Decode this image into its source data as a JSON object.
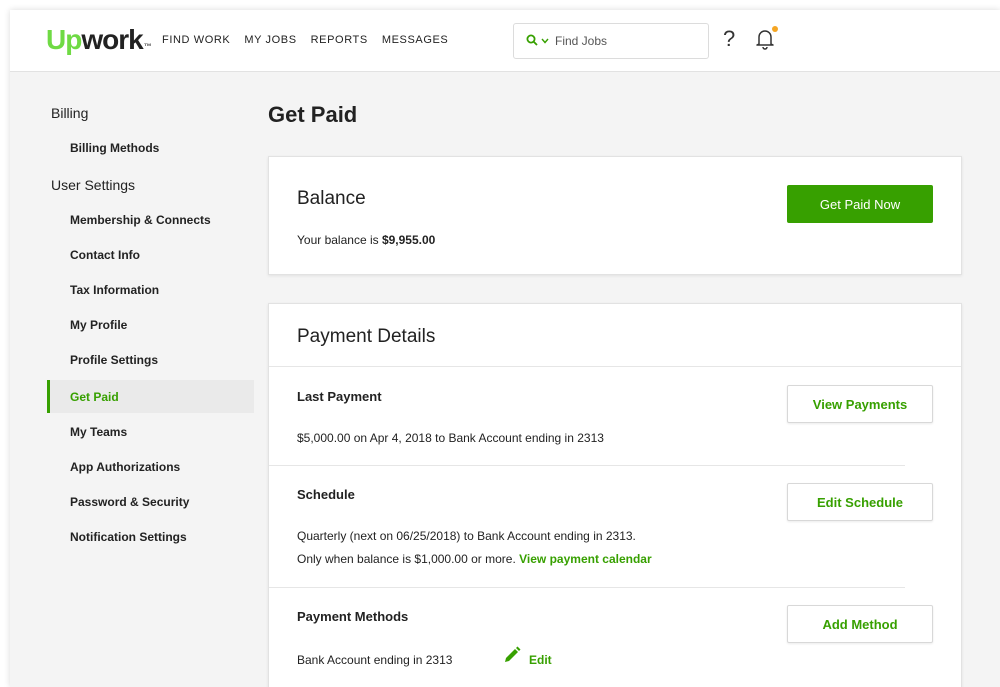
{
  "header": {
    "logo": {
      "up": "Up",
      "work": "work",
      "tm": "™"
    },
    "nav": [
      "FIND WORK",
      "MY JOBS",
      "REPORTS",
      "MESSAGES"
    ],
    "search": {
      "placeholder": "Find Jobs",
      "icon": "search-icon"
    },
    "help_label": "?",
    "notification_dot_color": "#f5a623"
  },
  "sidebar": {
    "billing_title": "Billing",
    "billing_items": [
      "Billing Methods"
    ],
    "settings_title": "User Settings",
    "settings_items": [
      "Membership & Connects",
      "Contact Info",
      "Tax Information",
      "My Profile",
      "Profile Settings",
      "Get Paid",
      "My Teams",
      "App Authorizations",
      "Password & Security",
      "Notification Settings"
    ],
    "active_item": "Get Paid"
  },
  "main": {
    "title": "Get Paid",
    "balance": {
      "title": "Balance",
      "text_prefix": "Your balance is ",
      "amount": "$9,955.00",
      "button": "Get Paid Now"
    },
    "payment_details": {
      "title": "Payment Details",
      "last_payment": {
        "title": "Last Payment",
        "text": "$5,000.00 on Apr 4, 2018 to Bank Account ending in 2313",
        "button": "View Payments"
      },
      "schedule": {
        "title": "Schedule",
        "line1": "Quarterly (next on 06/25/2018) to Bank Account ending in 2313.",
        "line2_prefix": "Only when balance is $1,000.00 or more. ",
        "line2_link": "View payment calendar",
        "button": "Edit Schedule"
      },
      "payment_methods": {
        "title": "Payment Methods",
        "account": "Bank Account ending in 2313",
        "edit_label": "Edit",
        "button": "Add Method"
      }
    }
  },
  "colors": {
    "brand_green": "#37a000",
    "logo_green": "#6fda44"
  }
}
